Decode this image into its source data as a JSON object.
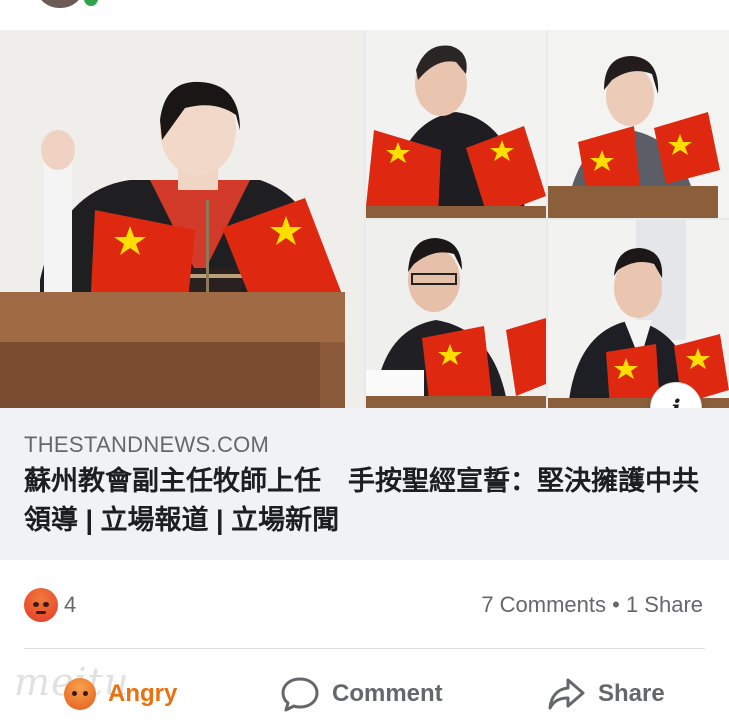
{
  "post": {
    "link": {
      "domain": "THESTANDNEWS.COM",
      "headline": "蘇州教會副主任牧師上任　手按聖經宣誓：堅決擁護中共領導 | 立場報道 | 立場新聞"
    },
    "photo_tiles": [
      "main-pledge-photo",
      "photo-2",
      "photo-3",
      "photo-4",
      "photo-5"
    ]
  },
  "summary": {
    "reaction_icon": "angry-emoji",
    "reaction_count": "4",
    "stats": "7 Comments • 1 Share"
  },
  "actions": {
    "react_label": "Angry",
    "comment_label": "Comment",
    "share_label": "Share"
  },
  "watermark": "meitu",
  "colors": {
    "caption_bg": "#f0f2f5",
    "secondary_text": "#65676b",
    "angry_accent": "#e9710f",
    "flag_red": "#de2910",
    "flag_star": "#ffde00"
  }
}
